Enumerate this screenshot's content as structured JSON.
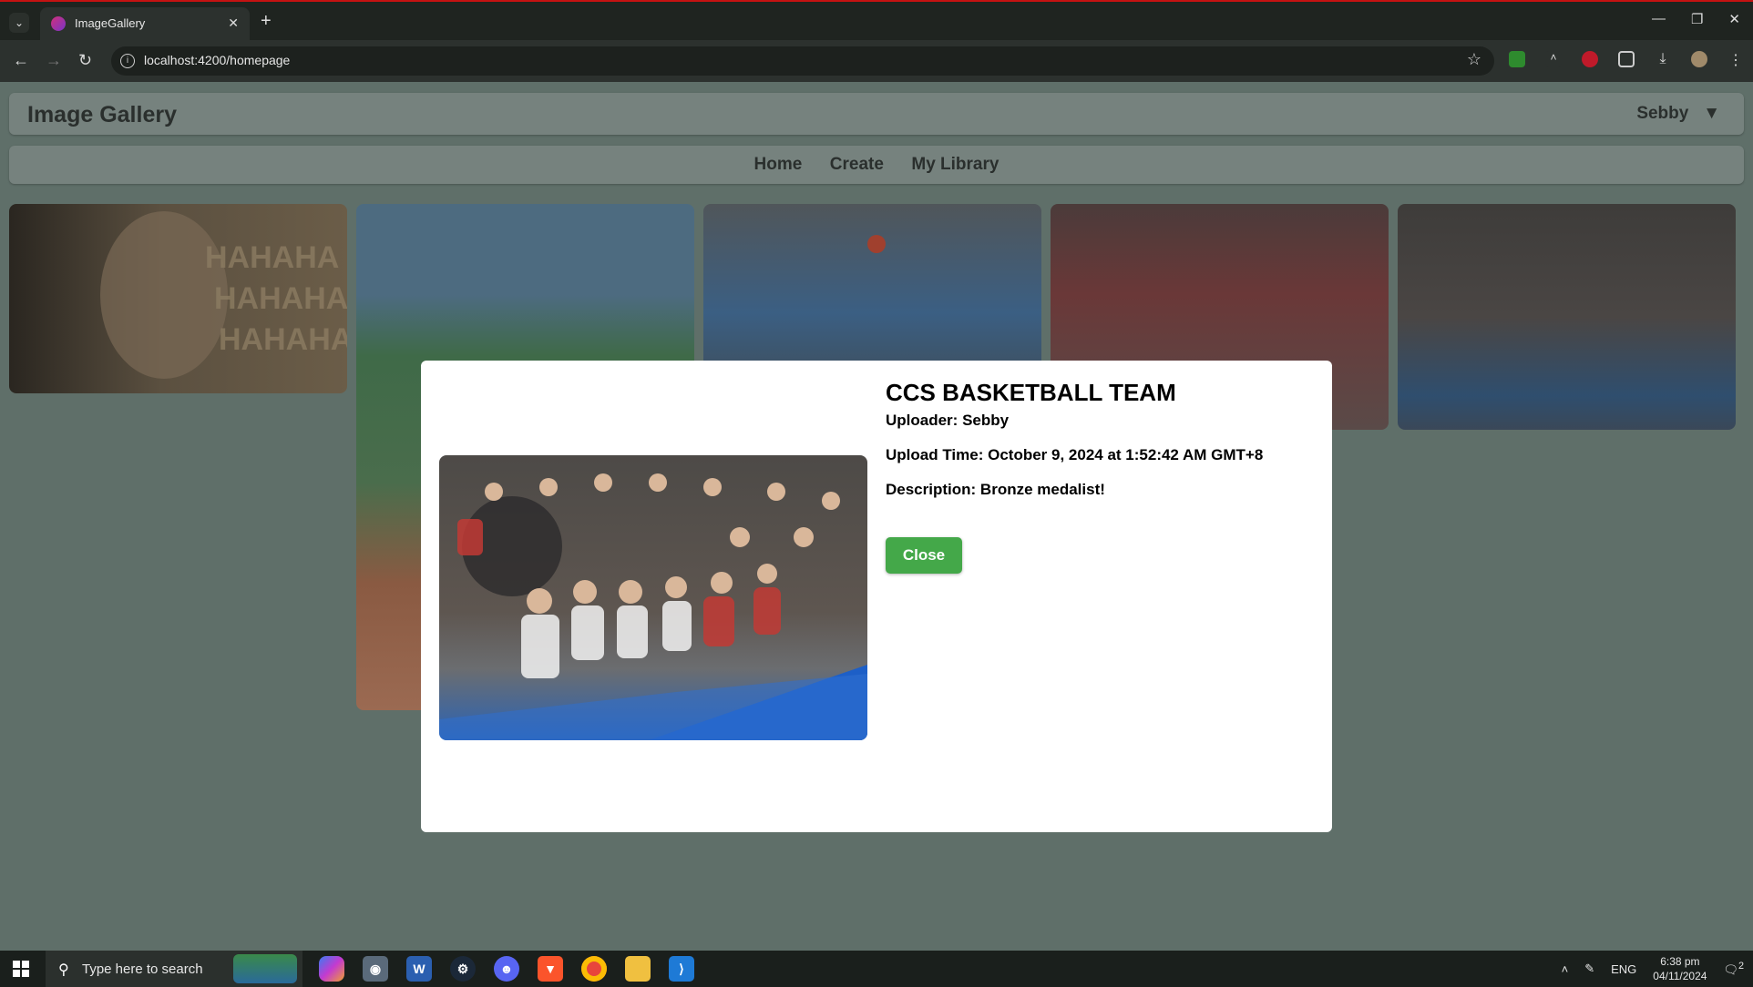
{
  "browser": {
    "tab_title": "ImageGallery",
    "url": "localhost:4200/homepage"
  },
  "app": {
    "title": "Image Gallery",
    "user_name": "Sebby",
    "user_menu_arrow": "▼",
    "nav": [
      "Home",
      "Create",
      "My Library"
    ]
  },
  "modal": {
    "title": "CCS BASKETBALL TEAM",
    "uploader_label": "Uploader:",
    "uploader": "Sebby",
    "upload_time_label": "Upload Time:",
    "upload_time": "October 9, 2024 at 1:52:42 AM GMT+8",
    "description_label": "Description:",
    "description": "Bronze medalist!",
    "close_label": "Close"
  },
  "taskbar": {
    "search_placeholder": "Type here to search",
    "language": "ENG",
    "time": "6:38 pm",
    "date": "04/11/2024",
    "notifications": "2",
    "apps": [
      "copilot-icon",
      "camera-icon",
      "word-icon",
      "steam-icon",
      "discord-icon",
      "brave-icon",
      "chrome-icon",
      "file-explorer-icon",
      "vscode-icon"
    ]
  }
}
